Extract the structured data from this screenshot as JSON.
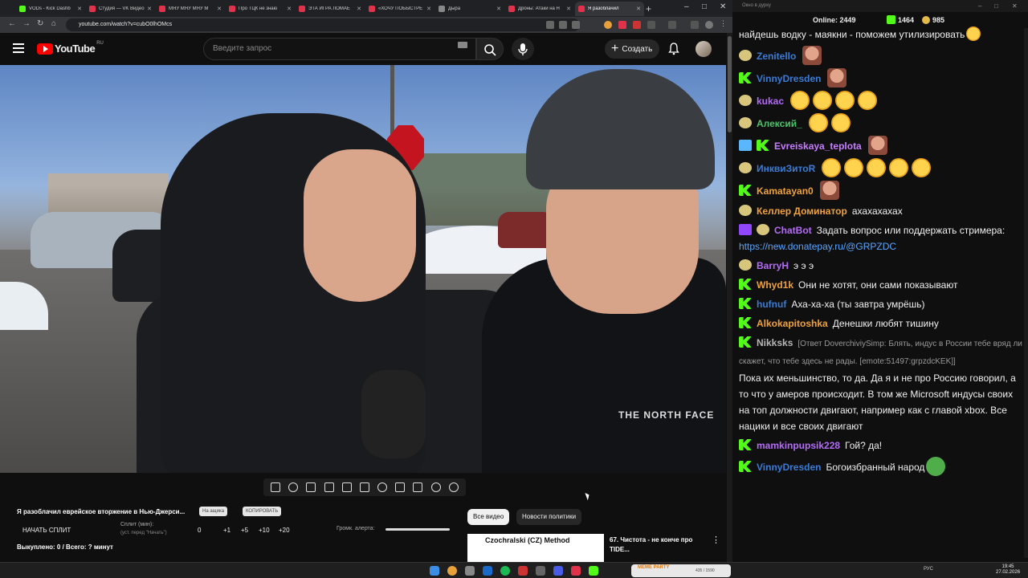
{
  "browser": {
    "tabs": [
      {
        "title": "VODs - Kick Dashb",
        "color": "#53fc18"
      },
      {
        "title": "Студия — VK Видео",
        "color": "#e0324b"
      },
      {
        "title": "МЯУ МЯУ МЯУ M",
        "color": "#e0324b"
      },
      {
        "title": "Про ТЦК не знаю",
        "color": "#e0324b"
      },
      {
        "title": "ЭТА ИГРА ЛОМАЕ",
        "color": "#e0324b"
      },
      {
        "title": "«ХОЧУ ПОБЫСТРЕ",
        "color": "#e0324b"
      },
      {
        "title": "Дыра",
        "color": "#888888"
      },
      {
        "title": "Дроны: Атаки на Н",
        "color": "#e0324b"
      },
      {
        "title": "Я разоблачил",
        "color": "#e0324b"
      }
    ],
    "new_tab": "+",
    "win_min": "–",
    "win_max": "□",
    "win_close": "✕",
    "url": "youtube.com/watch?v=cubO0lhOMcs"
  },
  "youtube": {
    "logo_text": "YouTube",
    "logo_region": "RU",
    "search_placeholder": "Введите запрос",
    "create_label": "Создать",
    "chips": {
      "all": "Все видео",
      "news": "Новости политики"
    },
    "rec_thumb_text": "Czochralski (CZ) Method",
    "rec_title": "67. Чистота - не конче про TIDE...",
    "more_icon": "⋮"
  },
  "panel": {
    "video_title": "Я разоблачил еврейское вторжение в Нью-Джерси...",
    "pill_1": "На ащика",
    "pill_2": "КОПИРОВАТЬ",
    "start_split": "НАЧАТЬ СПЛИТ",
    "split_label": "Сплит (мин):",
    "split_sub": "(уст. перед \"Начать\")",
    "split_values": [
      "0",
      "+1",
      "+5",
      "+10",
      "+20"
    ],
    "alert_label": "Громк. алерта:",
    "cut_line": "Выкуплено: 0 / Всего: ? минут"
  },
  "video": {
    "shirt_logo": "THE NORTH FACE"
  },
  "chat": {
    "window_title": "Окно в дурку",
    "online_label": "Online:",
    "online": "2449",
    "kick_count": "1464",
    "other_count": "985",
    "messages": [
      {
        "badge": "none",
        "user": "",
        "color": "#ffffff",
        "text": "найдешь водку - маякни - поможем утилизировать",
        "emotes": [
          "laugh"
        ]
      },
      {
        "badge": "mod",
        "user": "Zenitello",
        "color": "#3a7bd5",
        "text": "",
        "emotes": [
          "face"
        ]
      },
      {
        "badge": "kick",
        "user": "VinnyDresden",
        "color": "#3a7bd5",
        "text": "",
        "emotes": [
          "face"
        ]
      },
      {
        "badge": "mod",
        "user": "kukac",
        "color": "#b36cf5",
        "text": "",
        "emotes": [
          "laugh",
          "laugh",
          "laugh",
          "laugh"
        ]
      },
      {
        "badge": "mod",
        "user": "Алексий_",
        "color": "#4fc06a",
        "text": "",
        "emotes": [
          "laugh",
          "laugh"
        ]
      },
      {
        "badge": "sword",
        "user": "Evreiskaya_teplota",
        "color": "#c77dff",
        "text": "",
        "emotes": [
          "face"
        ]
      },
      {
        "badge": "mod",
        "user": "ИнквиЗитоR",
        "color": "#3a7bd5",
        "text": "",
        "emotes": [
          "laugh",
          "laugh",
          "laugh",
          "laugh",
          "laugh"
        ]
      },
      {
        "badge": "kick",
        "user": "Kamatayan0",
        "color": "#f0a23a",
        "text": "",
        "emotes": [
          "face"
        ]
      },
      {
        "badge": "mod",
        "user": "Келлер Доминатор",
        "color": "#f0a23a",
        "text": "ахахахахах",
        "emotes": []
      },
      {
        "badge": "bot",
        "user": "ChatBot",
        "color": "#b36cf5",
        "text": "Задать вопрос или поддержать стримера:",
        "link": "https://new.donatepay.ru/@GRPZDC",
        "emotes": []
      },
      {
        "badge": "mod",
        "user": "BarryH",
        "color": "#b36cf5",
        "text": "э э э",
        "emotes": []
      },
      {
        "badge": "kick",
        "user": "Whyd1k",
        "color": "#f0a23a",
        "text": "Они не хотят, они сами показывают",
        "emotes": []
      },
      {
        "badge": "kick",
        "user": "hufnuf",
        "color": "#3a7bd5",
        "text": "Аха-ха-ха (ты завтра умрёшь)",
        "emotes": []
      },
      {
        "badge": "kick",
        "user": "Alkokapitoshka",
        "color": "#f0a23a",
        "text": "Денешки любят тишину",
        "emotes": []
      },
      {
        "badge": "kick",
        "user": "Nikksks",
        "color": "#b7b7b7",
        "reply": "[Ответ DoverchiviySimp: Блять, индус в России тебе вряд ли скажет, что тебе здесь не рады. [emote:51497:grpzdcKEK]]",
        "text": "Пока их меньшинство, то да. Да я и не про Россию говорил, а то что у амеров происходит. В том же Microsoft индусы своих на топ должности двигают, например как с главой xbox. Все нацики и все своих двигают",
        "emotes": []
      },
      {
        "badge": "kick",
        "user": "mamkinpupsik228",
        "color": "#b36cf5",
        "text": "Гой? да!",
        "emotes": []
      },
      {
        "badge": "kick",
        "user": "VinnyDresden",
        "color": "#3a7bd5",
        "text": "Богоизбранный народ",
        "emotes": [
          "pepe"
        ]
      }
    ]
  },
  "taskbar": {
    "overlay_title": "MEME PARTY",
    "overlay_progress": "435 / 1590",
    "lang": "РУС",
    "time": "19:45",
    "date": "27.02.2026"
  }
}
